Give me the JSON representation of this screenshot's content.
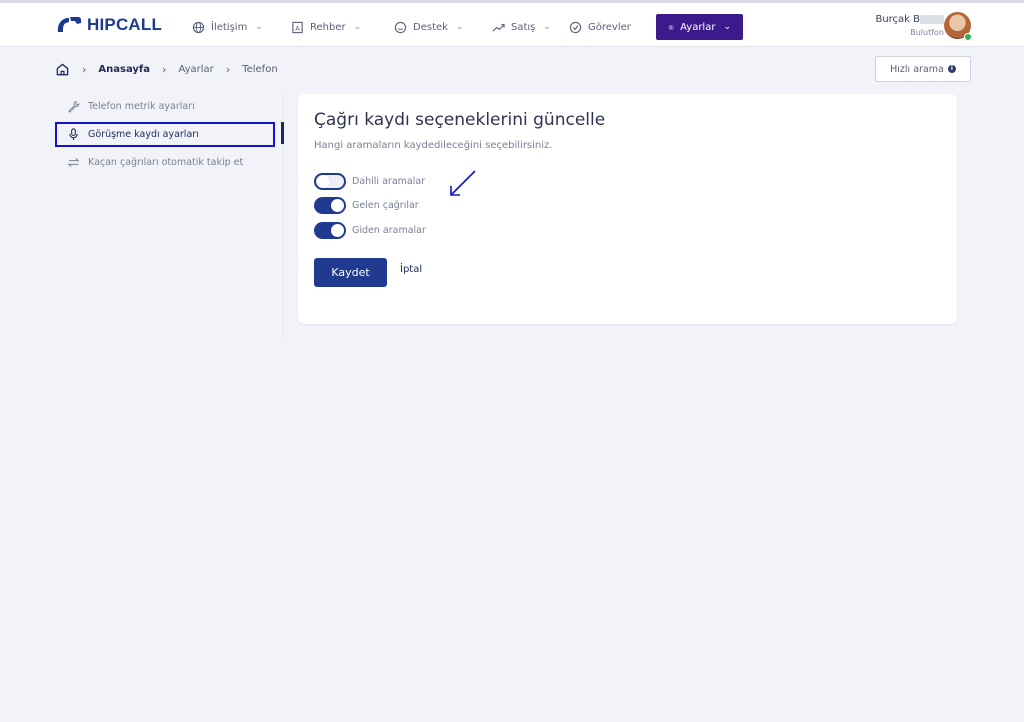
{
  "brand": {
    "name": "HIPCALL",
    "color": "#1d3a8f"
  },
  "nav": {
    "items": [
      {
        "label": "İletişim",
        "icon": "globe-icon",
        "dropdown": true
      },
      {
        "label": "Rehber",
        "icon": "contact-book-icon",
        "dropdown": true
      },
      {
        "label": "Destek",
        "icon": "support-smile-icon",
        "dropdown": true
      },
      {
        "label": "Satış",
        "icon": "trend-up-icon",
        "dropdown": true
      },
      {
        "label": "Görevler",
        "icon": "check-circle-icon",
        "dropdown": false
      },
      {
        "label": "Ayarlar",
        "icon": "gear-icon",
        "dropdown": true,
        "active": true
      }
    ],
    "active_color": "#3d1a8c"
  },
  "user": {
    "name": "Burçak B",
    "company": "Bulutfon",
    "status": "online"
  },
  "breadcrumb": {
    "items": [
      "Anasayfa",
      "Ayarlar",
      "Telefon"
    ]
  },
  "quick_call": {
    "label": "Hızlı arama"
  },
  "sidebar": {
    "items": [
      {
        "label": "Telefon metrik ayarları",
        "icon": "wrench-icon"
      },
      {
        "label": "Görüşme kaydı ayarları",
        "icon": "microphone-icon",
        "active": true
      },
      {
        "label": "Kaçan çağrıları otomatik takip et",
        "icon": "repeat-arrows-icon"
      }
    ]
  },
  "card": {
    "title": "Çağrı kaydı seçeneklerini güncelle",
    "subtitle": "Hangi aramaların kaydedileceğini seçebilirsiniz.",
    "toggles": [
      {
        "label": "Dahili aramalar",
        "on": false
      },
      {
        "label": "Gelen çağrılar",
        "on": true
      },
      {
        "label": "Giden aramalar",
        "on": true
      }
    ],
    "save_label": "Kaydet",
    "cancel_label": "İptal"
  },
  "colors": {
    "primary": "#1f3a8f",
    "annotation": "#1212c9"
  }
}
